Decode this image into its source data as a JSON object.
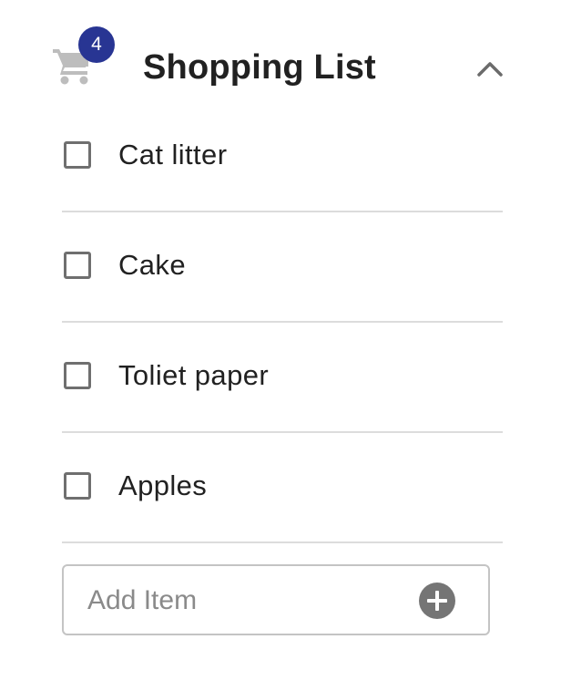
{
  "header": {
    "title": "Shopping List",
    "cart_icon": "shopping-cart-icon",
    "badge_count": "4",
    "collapse_icon": "chevron-up-icon"
  },
  "items": [
    {
      "label": "Cat litter",
      "checked": false
    },
    {
      "label": "Cake",
      "checked": false
    },
    {
      "label": "Toliet paper",
      "checked": false
    },
    {
      "label": "Apples",
      "checked": false
    }
  ],
  "add_item": {
    "placeholder": "Add Item",
    "value": "",
    "button_icon": "add-circle-icon"
  },
  "colors": {
    "badge": "#283593",
    "cart_icon": "#bdbdbd",
    "add_button": "#757575",
    "checkbox_border": "#6f6f6f",
    "divider": "#dcdcdc"
  }
}
